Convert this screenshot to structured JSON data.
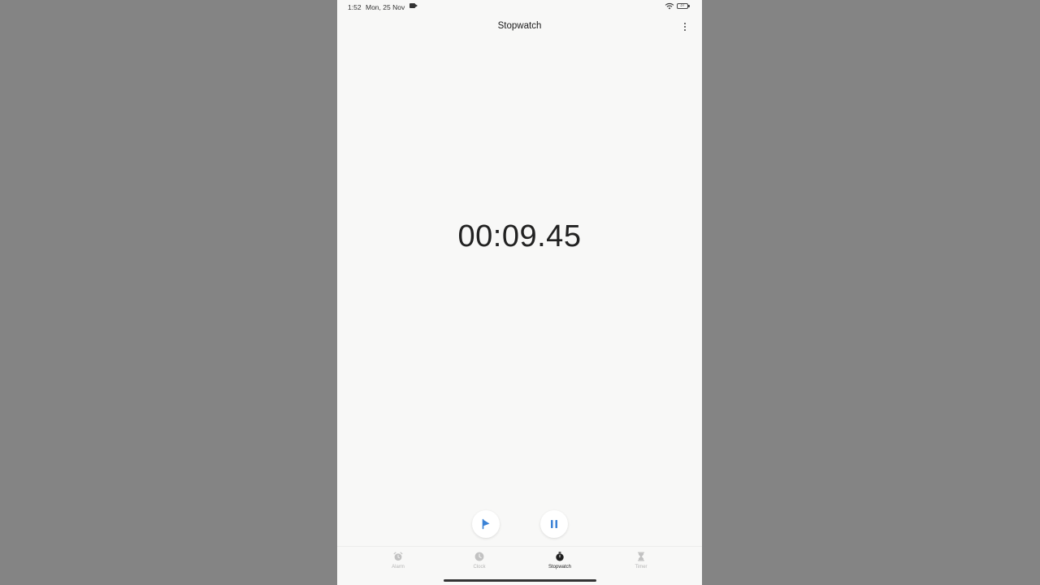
{
  "status_bar": {
    "time": "1:52",
    "date": "Mon, 25 Nov",
    "battery": "37",
    "icons": [
      "video-camera-icon",
      "wifi-icon",
      "battery-icon"
    ]
  },
  "header": {
    "title": "Stopwatch",
    "menu_icon": "more-vertical-icon"
  },
  "stopwatch": {
    "elapsed": "00:09.45"
  },
  "controls": {
    "lap_icon": "flag-icon",
    "pause_icon": "pause-icon",
    "accent_color": "#3b82d6"
  },
  "bottom_nav": {
    "items": [
      {
        "label": "Alarm",
        "icon": "alarm-clock-icon",
        "active": false
      },
      {
        "label": "Clock",
        "icon": "clock-icon",
        "active": false
      },
      {
        "label": "Stopwatch",
        "icon": "stopwatch-icon",
        "active": true
      },
      {
        "label": "Timer",
        "icon": "hourglass-icon",
        "active": false
      }
    ]
  },
  "colors": {
    "background": "#f8f8f7",
    "text": "#222222",
    "inactive": "#b5b5b5"
  }
}
